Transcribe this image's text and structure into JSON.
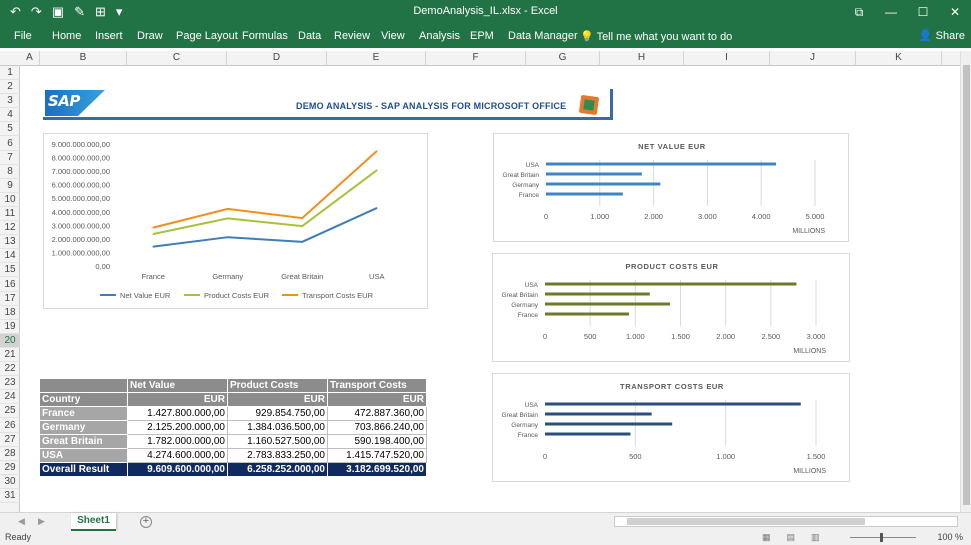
{
  "titlebar": {
    "title": "DemoAnalysis_IL.xlsx  -  Excel",
    "qat": [
      "↶",
      "↷",
      "▣",
      "✎",
      "⊞",
      "▾"
    ],
    "window_buttons": [
      "⧉",
      "—",
      "☐",
      "✕"
    ]
  },
  "ribbon": {
    "tabs": [
      "File",
      "Home",
      "Insert",
      "Draw",
      "Page Layout",
      "Formulas",
      "Data",
      "Review",
      "View",
      "Analysis",
      "EPM",
      "Data Manager"
    ],
    "tell_me": "Tell me what you want to do",
    "share": "Share"
  },
  "columns": [
    "A",
    "B",
    "C",
    "D",
    "E",
    "F",
    "G",
    "H",
    "I",
    "J",
    "K"
  ],
  "rows": [
    "1",
    "2",
    "3",
    "4",
    "5",
    "6",
    "7",
    "8",
    "9",
    "10",
    "11",
    "12",
    "13",
    "14",
    "15",
    "16",
    "17",
    "18",
    "19",
    "20",
    "21",
    "22",
    "23",
    "24",
    "25",
    "26",
    "27",
    "28",
    "29",
    "30",
    "31"
  ],
  "selected_row": "20",
  "banner": {
    "logo_text": "SAP",
    "title": "DEMO ANALYSIS - SAP ANALYSIS FOR MICROSOFT OFFICE"
  },
  "chart_data": [
    {
      "type": "line",
      "title": "",
      "categories": [
        "France",
        "Germany",
        "Great Britain",
        "USA"
      ],
      "series": [
        {
          "name": "Net Value EUR",
          "color": "#3f7db8",
          "values": [
            1427800000,
            2125200000,
            1782000000,
            4274600000
          ]
        },
        {
          "name": "Product Costs EUR",
          "color": "#a6c23a",
          "values": [
            2357654750,
            3509236500,
            2942527500,
            7058433250
          ]
        },
        {
          "name": "Transport Costs EUR",
          "color": "#f28e1c",
          "values": [
            2830542110,
            4213102740,
            3532725900,
            8474180990
          ]
        }
      ],
      "yticks": [
        "0,00",
        "1.000.000.000,00",
        "2.000.000.000,00",
        "3.000.000.000,00",
        "4.000.000.000,00",
        "5.000.000.000,00",
        "6.000.000.000,00",
        "7.000.000.000,00",
        "8.000.000.000,00",
        "9.000.000.000,00"
      ],
      "ylim": [
        0,
        9000000000
      ],
      "legend": "bottom"
    },
    {
      "type": "bar",
      "orientation": "horizontal",
      "title": "NET VALUE EUR",
      "categories": [
        "USA",
        "Great Britain",
        "Germany",
        "France"
      ],
      "values": [
        4274.6,
        1782.0,
        2125.2,
        1427.8
      ],
      "xticks": [
        "0",
        "1.000",
        "2.000",
        "3.000",
        "4.000",
        "5.000"
      ],
      "xlim": [
        0,
        5000
      ],
      "xlabel": "MILLIONS",
      "color": "#3f86c0"
    },
    {
      "type": "bar",
      "orientation": "horizontal",
      "title": "PRODUCT COSTS EUR",
      "categories": [
        "USA",
        "Great Britain",
        "Germany",
        "France"
      ],
      "values": [
        2783.8,
        1160.5,
        1384.0,
        929.9
      ],
      "xticks": [
        "0",
        "500",
        "1.000",
        "1.500",
        "2.000",
        "2.500",
        "3.000"
      ],
      "xlim": [
        0,
        3000
      ],
      "xlabel": "MILLIONS",
      "color": "#6b7a2a"
    },
    {
      "type": "bar",
      "orientation": "horizontal",
      "title": "TRANSPORT COSTS EUR",
      "categories": [
        "USA",
        "Great Britain",
        "Germany",
        "France"
      ],
      "values": [
        1415.7,
        590.2,
        703.9,
        472.9
      ],
      "xticks": [
        "0",
        "500",
        "1.000",
        "1.500"
      ],
      "xlim": [
        0,
        1500
      ],
      "xlabel": "MILLIONS",
      "color": "#2a4f7a"
    }
  ],
  "table": {
    "header": [
      "",
      "Net Value",
      "Product Costs",
      "Transport Costs"
    ],
    "subheader": [
      "Country",
      "EUR",
      "EUR",
      "EUR"
    ],
    "rows": [
      [
        "France",
        "1.427.800.000,00",
        "929.854.750,00",
        "472.887.360,00"
      ],
      [
        "Germany",
        "2.125.200.000,00",
        "1.384.036.500,00",
        "703.866.240,00"
      ],
      [
        "Great Britain",
        "1.782.000.000,00",
        "1.160.527.500,00",
        "590.198.400,00"
      ],
      [
        "USA",
        "4.274.600.000,00",
        "2.783.833.250,00",
        "1.415.747.520,00"
      ]
    ],
    "total": [
      "Overall Result",
      "9.609.600.000,00",
      "6.258.252.000,00",
      "3.182.699.520,00"
    ]
  },
  "sheets": [
    "Sheet1"
  ],
  "status": {
    "ready": "Ready",
    "zoom": "100 %"
  }
}
